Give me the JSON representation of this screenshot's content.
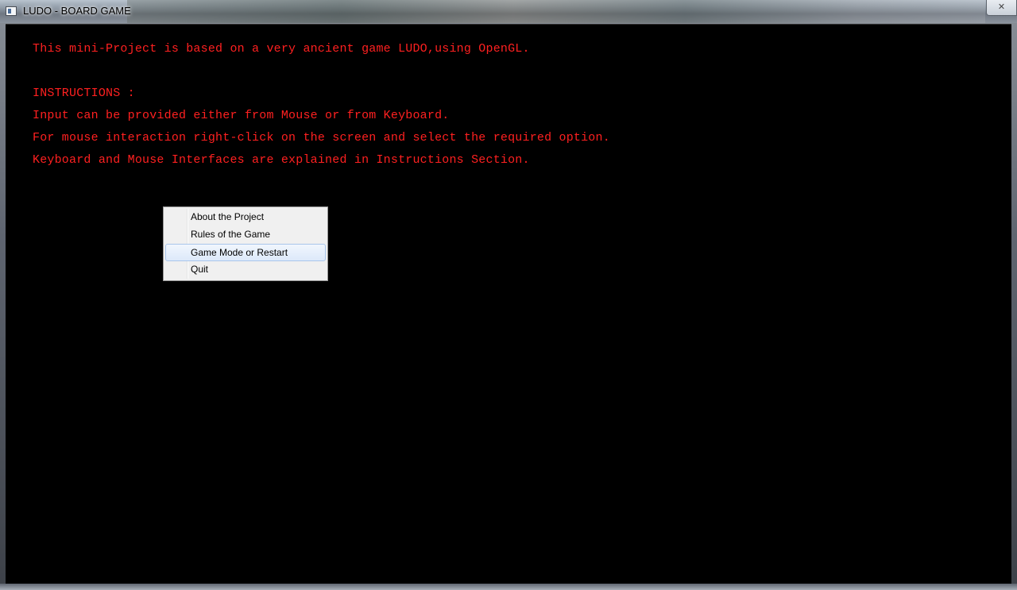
{
  "window": {
    "title": "LUDO - BOARD GAME",
    "close_glyph": "✕"
  },
  "content": {
    "lines": [
      "This mini-Project is based on a very ancient game LUDO,using OpenGL.",
      "INSTRUCTIONS :",
      "Input can be provided either from Mouse or from Keyboard.",
      "For mouse interaction right-click on the screen and select the required option.",
      "Keyboard and Mouse Interfaces are explained in Instructions Section."
    ],
    "text_color": "#ff2020",
    "background_color": "#000000"
  },
  "context_menu": {
    "items": [
      {
        "label": "About the Project"
      },
      {
        "label": "Rules of the Game"
      },
      {
        "label": "Game Mode or Restart",
        "highlighted": true
      },
      {
        "label": "Quit"
      }
    ],
    "highlight_color": "#dde9fa"
  }
}
